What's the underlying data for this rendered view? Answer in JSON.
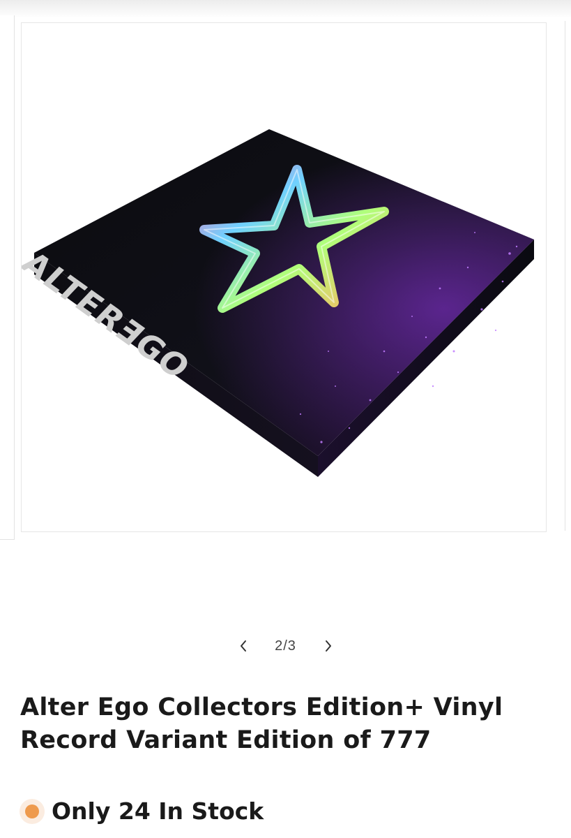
{
  "gallery": {
    "product_image_alt": "Alter Ego Collectors Edition box",
    "box_spine_text": "ALTERƎGO",
    "counter": "2/3",
    "prev_icon": "chevron-left-icon",
    "next_icon": "chevron-right-icon"
  },
  "product": {
    "title": "Alter Ego Collectors Edition+ Vinyl Record Variant Edition of 777",
    "stock_text": "Only 24 In Stock",
    "stock_color": "#ee9a4d"
  }
}
